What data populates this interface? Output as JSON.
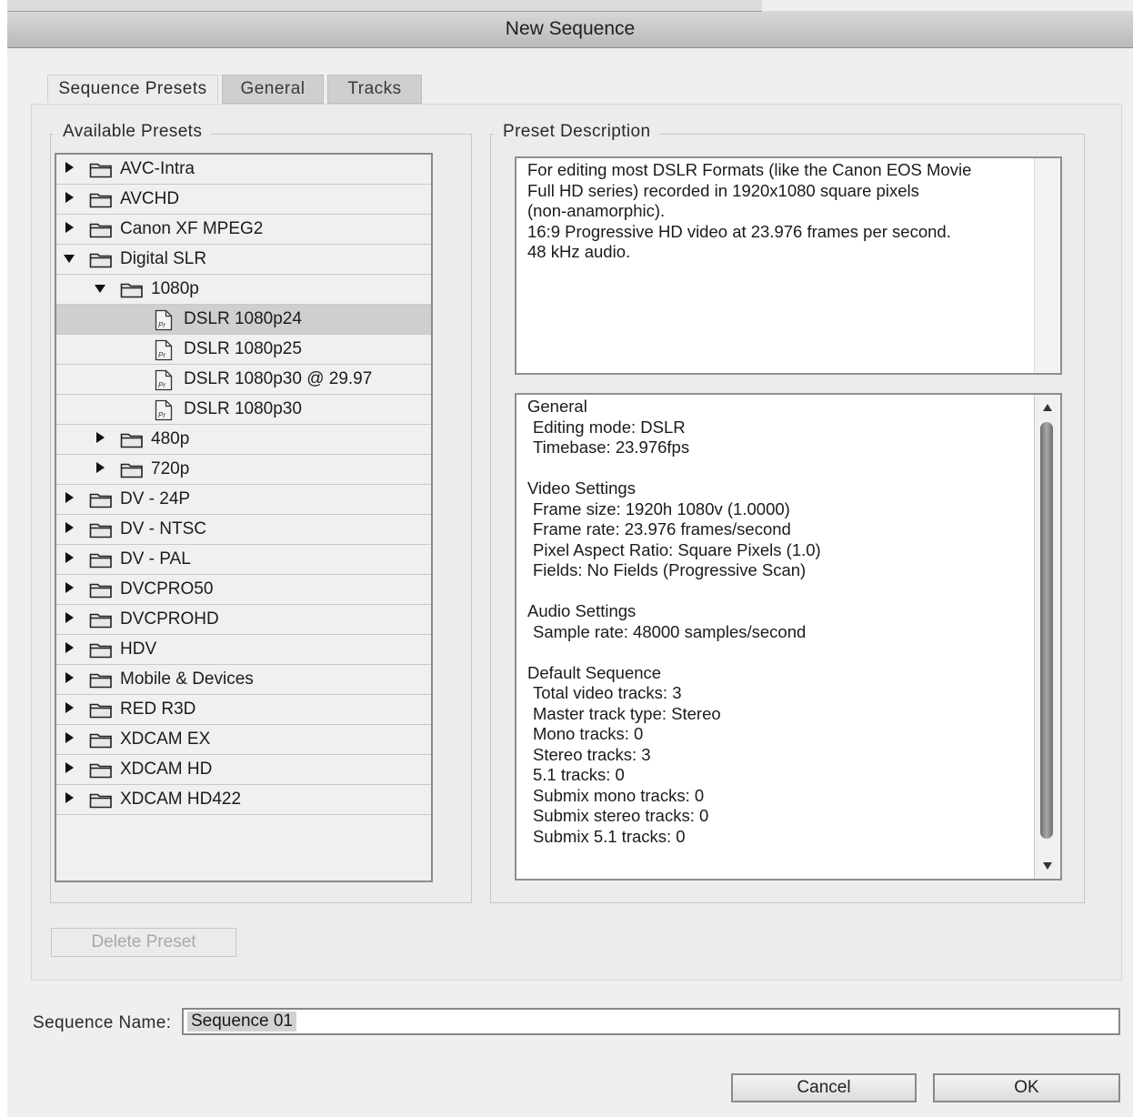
{
  "window": {
    "title": "New Sequence"
  },
  "tabs": [
    {
      "label": "Sequence Presets",
      "active": true
    },
    {
      "label": "General",
      "active": false
    },
    {
      "label": "Tracks",
      "active": false
    }
  ],
  "available_presets": {
    "label": "Available Presets",
    "tree": [
      {
        "label": "AVC-Intra",
        "type": "folder",
        "depth": 0,
        "expanded": false
      },
      {
        "label": "AVCHD",
        "type": "folder",
        "depth": 0,
        "expanded": false
      },
      {
        "label": "Canon XF MPEG2",
        "type": "folder",
        "depth": 0,
        "expanded": false
      },
      {
        "label": "Digital SLR",
        "type": "folder",
        "depth": 0,
        "expanded": true
      },
      {
        "label": "1080p",
        "type": "folder",
        "depth": 1,
        "expanded": true
      },
      {
        "label": "DSLR 1080p24",
        "type": "preset",
        "depth": 2,
        "selected": true
      },
      {
        "label": "DSLR 1080p25",
        "type": "preset",
        "depth": 2
      },
      {
        "label": "DSLR 1080p30 @ 29.97",
        "type": "preset",
        "depth": 2
      },
      {
        "label": "DSLR 1080p30",
        "type": "preset",
        "depth": 2
      },
      {
        "label": "480p",
        "type": "folder",
        "depth": 1,
        "expanded": false
      },
      {
        "label": "720p",
        "type": "folder",
        "depth": 1,
        "expanded": false
      },
      {
        "label": "DV - 24P",
        "type": "folder",
        "depth": 0,
        "expanded": false
      },
      {
        "label": "DV - NTSC",
        "type": "folder",
        "depth": 0,
        "expanded": false
      },
      {
        "label": "DV - PAL",
        "type": "folder",
        "depth": 0,
        "expanded": false
      },
      {
        "label": "DVCPRO50",
        "type": "folder",
        "depth": 0,
        "expanded": false
      },
      {
        "label": "DVCPROHD",
        "type": "folder",
        "depth": 0,
        "expanded": false
      },
      {
        "label": "HDV",
        "type": "folder",
        "depth": 0,
        "expanded": false
      },
      {
        "label": "Mobile & Devices",
        "type": "folder",
        "depth": 0,
        "expanded": false
      },
      {
        "label": "RED R3D",
        "type": "folder",
        "depth": 0,
        "expanded": false
      },
      {
        "label": "XDCAM EX",
        "type": "folder",
        "depth": 0,
        "expanded": false
      },
      {
        "label": "XDCAM HD",
        "type": "folder",
        "depth": 0,
        "expanded": false
      },
      {
        "label": "XDCAM HD422",
        "type": "folder",
        "depth": 0,
        "expanded": false
      }
    ]
  },
  "preset_description": {
    "label": "Preset Description",
    "lines": [
      "For editing most DSLR Formats (like the Canon EOS Movie",
      "Full HD series) recorded in 1920x1080 square pixels",
      "(non-anamorphic).",
      "16:9 Progressive HD video at 23.976 frames per second.",
      "48 kHz audio."
    ]
  },
  "preset_info": [
    {
      "heading": "General",
      "items": [
        "Editing mode: DSLR",
        "Timebase: 23.976fps"
      ]
    },
    {
      "heading": "Video Settings",
      "items": [
        "Frame size: 1920h 1080v (1.0000)",
        "Frame rate: 23.976 frames/second",
        "Pixel Aspect Ratio: Square Pixels (1.0)",
        "Fields: No Fields (Progressive Scan)"
      ]
    },
    {
      "heading": "Audio Settings",
      "items": [
        "Sample rate: 48000 samples/second"
      ]
    },
    {
      "heading": "Default Sequence",
      "items": [
        "Total video tracks: 3",
        "Master track type: Stereo",
        "Mono tracks: 0",
        "Stereo tracks: 3",
        "5.1 tracks: 0",
        "Submix mono tracks: 0",
        "Submix stereo tracks: 0",
        "Submix 5.1 tracks: 0"
      ]
    }
  ],
  "buttons": {
    "delete_preset": "Delete Preset",
    "cancel": "Cancel",
    "ok": "OK"
  },
  "sequence_name": {
    "label": "Sequence Name:",
    "value": "Sequence 01"
  }
}
